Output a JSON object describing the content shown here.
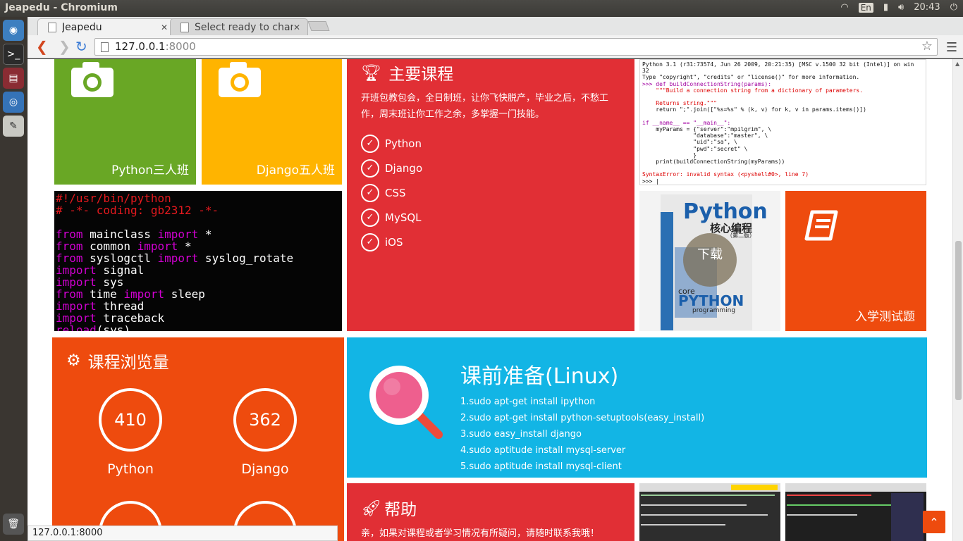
{
  "panel": {
    "window_title": "Jeapedu - Chromium",
    "lang": "En",
    "clock": "20:43"
  },
  "browser": {
    "tabs": [
      {
        "title": "Jeapedu"
      },
      {
        "title": "Select ready to chang"
      }
    ],
    "url_host": "127.0.0.1",
    "url_port": ":8000",
    "status_url": "127.0.0.1:8000"
  },
  "tiles": {
    "python_class": "Python三人班",
    "django_class": "Django五人班",
    "code_lines": [
      [
        {
          "t": "#!/usr/bin/python",
          "c": "r"
        }
      ],
      [
        {
          "t": "# -*- coding: gb2312 -*-",
          "c": "r"
        }
      ],
      [
        {
          "t": " ",
          "c": ""
        }
      ],
      [
        {
          "t": "from",
          "c": "m"
        },
        {
          "t": " mainclass ",
          "c": ""
        },
        {
          "t": "import",
          "c": "m"
        },
        {
          "t": " *",
          "c": ""
        }
      ],
      [
        {
          "t": "from",
          "c": "m"
        },
        {
          "t": " common ",
          "c": ""
        },
        {
          "t": "import",
          "c": "m"
        },
        {
          "t": " *",
          "c": ""
        }
      ],
      [
        {
          "t": "from",
          "c": "m"
        },
        {
          "t": " syslogctl ",
          "c": ""
        },
        {
          "t": "import",
          "c": "m"
        },
        {
          "t": " syslog_rotate",
          "c": ""
        }
      ],
      [
        {
          "t": "import",
          "c": "m"
        },
        {
          "t": " signal",
          "c": ""
        }
      ],
      [
        {
          "t": "import",
          "c": "m"
        },
        {
          "t": " sys",
          "c": ""
        }
      ],
      [
        {
          "t": "from",
          "c": "m"
        },
        {
          "t": " time ",
          "c": ""
        },
        {
          "t": "import",
          "c": "m"
        },
        {
          "t": " sleep",
          "c": ""
        }
      ],
      [
        {
          "t": "import",
          "c": "m"
        },
        {
          "t": " thread",
          "c": ""
        }
      ],
      [
        {
          "t": "import",
          "c": "m"
        },
        {
          "t": " traceback",
          "c": ""
        }
      ],
      [
        {
          "t": "reload",
          "c": "m"
        },
        {
          "t": "(sys)",
          "c": ""
        }
      ]
    ],
    "main_courses": {
      "title": "主要课程",
      "desc": "开班包教包会，全日制班，让你飞快脱产，毕业之后，不愁工作，周末班让你工作之余，多掌握一门技能。",
      "items": [
        "Python",
        "Django",
        "CSS",
        "MySQL",
        "iOS"
      ]
    },
    "shell_lines": [
      "Python 3.1 (r31:73574, Jun 26 2009, 20:21:35) [MSC v.1500 32 bit (Intel)] on win",
      "32",
      "Type \"copyright\", \"credits\" or \"license()\" for more information.",
      ">>> def buildConnectionString(params):",
      "    \"\"\"Build a connection string from a dictionary of parameters.",
      "",
      "    Returns string.\"\"\"",
      "    return \";\".join([\"%s=%s\" % (k, v) for k, v in params.items()])",
      "",
      "if __name__ == \"__main__\":",
      "    myParams = {\"server\":\"mpilgrim\", \\",
      "               \"database\":\"master\", \\",
      "               \"uid\":\"sa\", \\",
      "               \"pwd\":\"secret\" \\",
      "               }",
      "    print(buildConnectionString(myParams))",
      "",
      "SyntaxError: invalid syntax (<pyshell#0>, line 7)",
      ">>> |"
    ],
    "book": {
      "title": "Python",
      "subtitle": "核心编程",
      "edition": "（第二版）",
      "core": "core",
      "python": "PYTHON",
      "programming": "programming",
      "download": "下载"
    },
    "entrance_test": "入学测试题",
    "views": {
      "title": "课程浏览量",
      "stats": [
        {
          "value": "410",
          "label": "Python"
        },
        {
          "value": "362",
          "label": "Django"
        }
      ]
    },
    "linux": {
      "title": "课前准备(Linux)",
      "steps": [
        "1.sudo apt-get install ipython",
        "2.sudo apt-get install python-setuptools(easy_install)",
        "3.sudo easy_install django",
        "4.sudo aptitude install mysql-server",
        "5.sudo aptitude install mysql-client"
      ]
    },
    "help": {
      "title": "帮助",
      "text": "亲，如果对课程或者学习情况有所疑问，请随时联系我哦！"
    }
  },
  "colors": {
    "green": "#69a725",
    "yellow": "#ffb400",
    "red": "#e12f35",
    "orange": "#ee4b0e",
    "blue": "#12b5e5"
  }
}
